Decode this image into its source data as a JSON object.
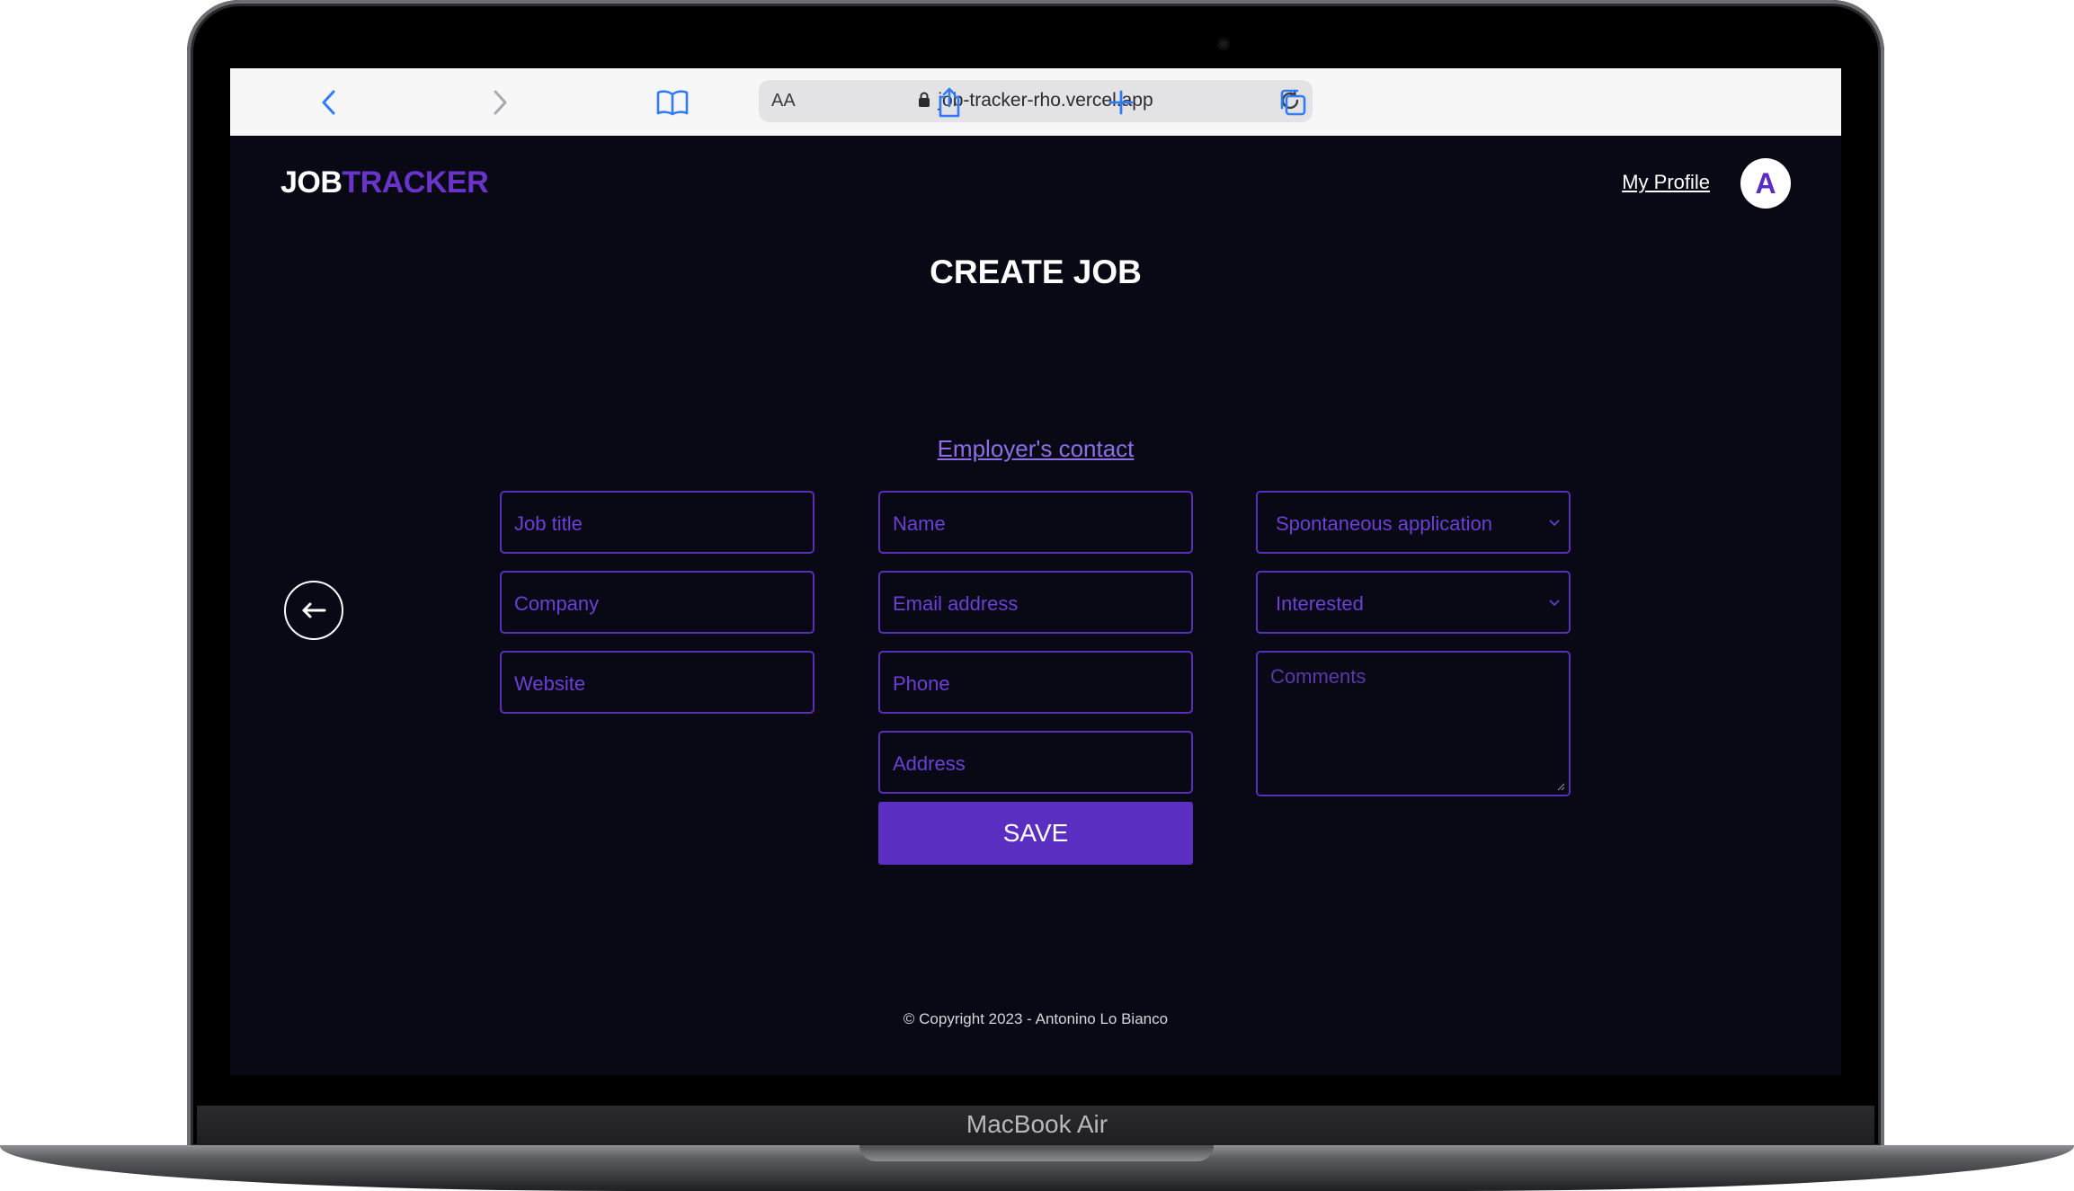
{
  "browser": {
    "text_size_label": "AA",
    "url": "job-tracker-rho.vercel.app"
  },
  "device": {
    "label": "MacBook Air"
  },
  "app": {
    "brand_part1": "JOB",
    "brand_part2": "TRACKER",
    "profile_link": "My Profile",
    "avatar_initial": "A",
    "page_title": "CREATE JOB",
    "section_link": "Employer's contact",
    "save_label": "SAVE",
    "footer": "© Copyright 2023 - Antonino Lo Bianco"
  },
  "form": {
    "job_title": "Job title",
    "company": "Company",
    "website": "Website",
    "name": "Name",
    "email": "Email address",
    "phone": "Phone",
    "address": "Address",
    "application_type": "Spontaneous application",
    "status": "Interested",
    "comments": "Comments"
  },
  "icons": {
    "back": "back-chevron-icon",
    "forward": "forward-chevron-icon",
    "bookmarks": "book-icon",
    "lock": "lock-icon",
    "reload": "reload-icon",
    "share": "share-icon",
    "new_tab": "plus-icon",
    "tabs": "tabs-icon",
    "back_arrow": "arrow-left-icon"
  },
  "colors": {
    "accent": "#5b2ec2",
    "brand_purple": "#6a33c9",
    "background": "#080915",
    "link": "#8f6fe6"
  }
}
